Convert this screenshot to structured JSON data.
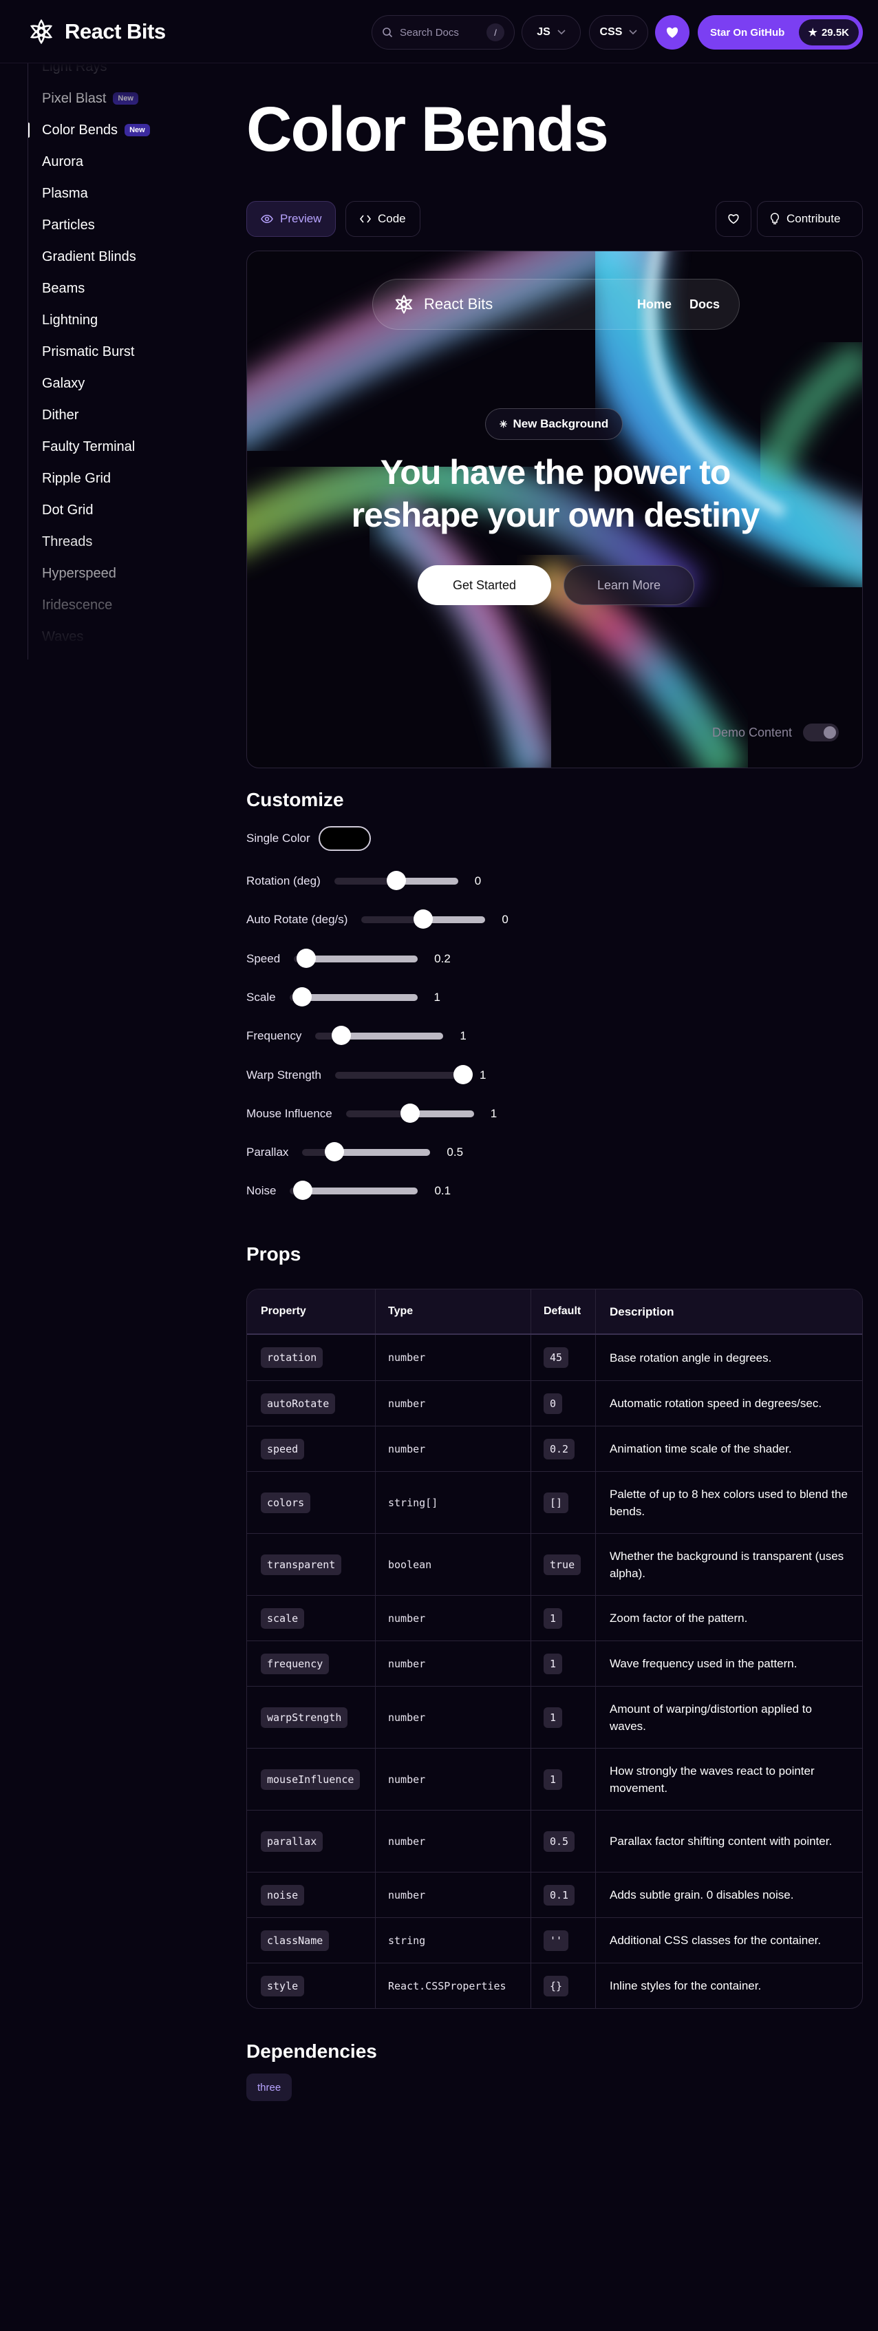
{
  "header": {
    "logo_text": "React Bits",
    "search_placeholder": "Search Docs",
    "search_shortcut": "/",
    "lang_select": "JS",
    "style_select": "CSS",
    "github_label": "Star On GitHub",
    "github_stars": "29.5K",
    "accent_color": "#7b3ff2"
  },
  "sidebar": {
    "items": [
      {
        "label": "Light Rays",
        "badge": ""
      },
      {
        "label": "Pixel Blast",
        "badge": "New"
      },
      {
        "label": "Color Bends",
        "badge": "New",
        "active": true
      },
      {
        "label": "Aurora",
        "badge": ""
      },
      {
        "label": "Plasma",
        "badge": ""
      },
      {
        "label": "Particles",
        "badge": ""
      },
      {
        "label": "Gradient Blinds",
        "badge": ""
      },
      {
        "label": "Beams",
        "badge": ""
      },
      {
        "label": "Lightning",
        "badge": ""
      },
      {
        "label": "Prismatic Burst",
        "badge": ""
      },
      {
        "label": "Galaxy",
        "badge": ""
      },
      {
        "label": "Dither",
        "badge": ""
      },
      {
        "label": "Faulty Terminal",
        "badge": ""
      },
      {
        "label": "Ripple Grid",
        "badge": ""
      },
      {
        "label": "Dot Grid",
        "badge": ""
      },
      {
        "label": "Threads",
        "badge": ""
      },
      {
        "label": "Hyperspeed",
        "badge": ""
      },
      {
        "label": "Iridescence",
        "badge": ""
      },
      {
        "label": "Waves",
        "badge": ""
      }
    ]
  },
  "page": {
    "title": "Color Bends",
    "tab_preview": "Preview",
    "tab_code": "Code",
    "contribute_label": "Contribute"
  },
  "demo": {
    "nav_logo": "React Bits",
    "nav_home": "Home",
    "nav_docs": "Docs",
    "badge": "New Background",
    "headline_line1": "You have the power to",
    "headline_line2": "reshape your own destiny",
    "btn_primary": "Get Started",
    "btn_secondary": "Learn More",
    "toggle_label": "Demo Content"
  },
  "customize": {
    "title": "Customize",
    "single_color_label": "Single Color",
    "sliders": [
      {
        "label": "Rotation (deg)",
        "value": "0",
        "fraction": 0.5
      },
      {
        "label": "Auto Rotate (deg/s)",
        "value": "0",
        "fraction": 0.5
      },
      {
        "label": "Speed",
        "value": "0.2",
        "fraction": 0.1
      },
      {
        "label": "Scale",
        "value": "1",
        "fraction": 0.1
      },
      {
        "label": "Frequency",
        "value": "1",
        "fraction": 0.2
      },
      {
        "label": "Warp Strength",
        "value": "1",
        "fraction": 1.0
      },
      {
        "label": "Mouse Influence",
        "value": "1",
        "fraction": 0.5
      },
      {
        "label": "Parallax",
        "value": "0.5",
        "fraction": 0.25
      },
      {
        "label": "Noise",
        "value": "0.1",
        "fraction": 0.1
      }
    ]
  },
  "props": {
    "title": "Props",
    "headers": [
      "Property",
      "Type",
      "Default",
      "Description"
    ],
    "rows": [
      {
        "property": "rotation",
        "type": "number",
        "default": "45",
        "description": "Base rotation angle in degrees."
      },
      {
        "property": "autoRotate",
        "type": "number",
        "default": "0",
        "description": "Automatic rotation speed in degrees/sec."
      },
      {
        "property": "speed",
        "type": "number",
        "default": "0.2",
        "description": "Animation time scale of the shader."
      },
      {
        "property": "colors",
        "type": "string[]",
        "default": "[]",
        "description": "Palette of up to 8 hex colors used to blend the bends."
      },
      {
        "property": "transparent",
        "type": "boolean",
        "default": "true",
        "description": "Whether the background is transparent (uses alpha)."
      },
      {
        "property": "scale",
        "type": "number",
        "default": "1",
        "description": "Zoom factor of the pattern."
      },
      {
        "property": "frequency",
        "type": "number",
        "default": "1",
        "description": "Wave frequency used in the pattern."
      },
      {
        "property": "warpStrength",
        "type": "number",
        "default": "1",
        "description": "Amount of warping/distortion applied to waves."
      },
      {
        "property": "mouseInfluence",
        "type": "number",
        "default": "1",
        "description": "How strongly the waves react to pointer movement."
      },
      {
        "property": "parallax",
        "type": "number",
        "default": "0.5",
        "description": "Parallax factor shifting content with pointer."
      },
      {
        "property": "noise",
        "type": "number",
        "default": "0.1",
        "description": "Adds subtle grain. 0 disables noise."
      },
      {
        "property": "className",
        "type": "string",
        "default": "''",
        "description": "Additional CSS classes for the container."
      },
      {
        "property": "style",
        "type": "React.CSSProperties",
        "default": "{}",
        "description": "Inline styles for the container."
      }
    ]
  },
  "dependencies": {
    "title": "Dependencies",
    "items": [
      "three"
    ]
  }
}
